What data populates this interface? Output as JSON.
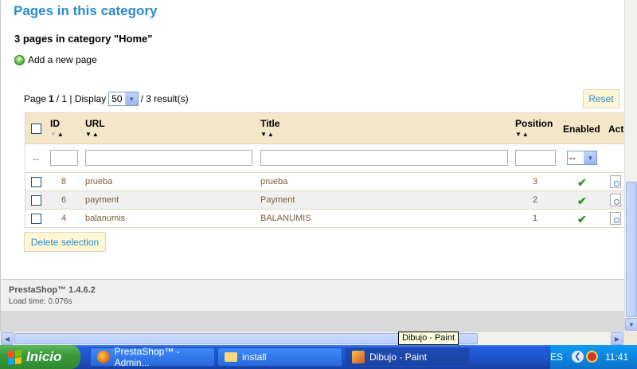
{
  "section": {
    "title": "Pages in this category",
    "count_text": "3 pages in category \"Home\"",
    "add_label": "Add a new page"
  },
  "pager": {
    "page_label": "Page",
    "page_current": "1",
    "page_total_text": "/ 1 | Display",
    "page_size": "50",
    "results_text": "/ 3 result(s)"
  },
  "reset_label": "Reset",
  "columns": {
    "id": "ID",
    "url": "URL",
    "title": "Title",
    "position": "Position",
    "enabled": "Enabled",
    "actions": "Acti"
  },
  "filter": {
    "dash": "--",
    "enabled_value": "--"
  },
  "rows": [
    {
      "id": "8",
      "url": "prueba",
      "title": "prueba",
      "position": "3"
    },
    {
      "id": "6",
      "url": "payment",
      "title": "Payment",
      "position": "2"
    },
    {
      "id": "4",
      "url": "balanumis",
      "title": "BALANUMIS",
      "position": "1"
    }
  ],
  "delete_label": "Delete selection",
  "footer": {
    "version": "PrestaShop™ 1.4.6.2",
    "load_time": "Load time: 0.076s"
  },
  "tooltip": "Dibujo - Paint",
  "taskbar": {
    "start_label": "Inicio",
    "tasks": [
      {
        "label": "PrestaShop™ - Admin..."
      },
      {
        "label": "install"
      },
      {
        "label": "Dibujo - Paint"
      }
    ],
    "lang": "ES",
    "clock": "11:41"
  },
  "colors": {
    "accent_blue": "#268ccd",
    "header_bg": "#f4e6c9",
    "button_bg": "#fff6d3",
    "enabled_green": "#2f9a1f"
  }
}
